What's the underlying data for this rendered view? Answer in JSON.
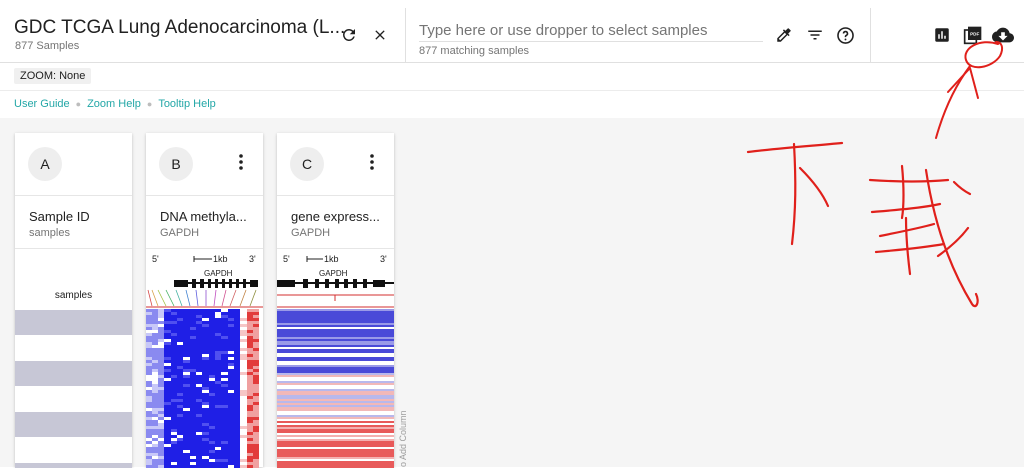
{
  "header": {
    "title": "GDC TCGA Lung Adenocarcinoma (L...",
    "sample_count": "877 Samples"
  },
  "search": {
    "placeholder": "Type here or use dropper to select samples",
    "match_count": "877 matching samples"
  },
  "zoom": {
    "label": "ZOOM: None"
  },
  "help_links": [
    {
      "label": "User Guide"
    },
    {
      "label": "Zoom Help"
    },
    {
      "label": "Tooltip Help"
    }
  ],
  "columns": [
    {
      "letter": "A",
      "field": "Sample ID",
      "sub": "samples",
      "track_label": "samples"
    },
    {
      "letter": "B",
      "field": "DNA methyla...",
      "sub": "GAPDH",
      "gene": "GAPDH",
      "scale": "1kb",
      "five": "5'",
      "three": "3'"
    },
    {
      "letter": "C",
      "field": "gene express...",
      "sub": "GAPDH",
      "gene": "GAPDH",
      "scale": "1kb",
      "five": "5'",
      "three": "3'"
    }
  ],
  "add_column": {
    "label": "o Add Column"
  },
  "annotation": {
    "text": "下载",
    "color": "#e0201b"
  },
  "icons": {
    "refresh": "refresh-icon",
    "close": "close-icon",
    "dropper": "dropper-icon",
    "filter": "filter-icon",
    "help": "help-icon",
    "chart": "bar-chart-icon",
    "pdf": "pdf-icon",
    "download": "cloud-download-icon",
    "kebab": "more-vert-icon"
  },
  "colors": {
    "accent": "#23a7a7",
    "heat_blue": "#1f1fe6",
    "heat_red": "#e23b3b",
    "band": "#c7c7d6"
  }
}
